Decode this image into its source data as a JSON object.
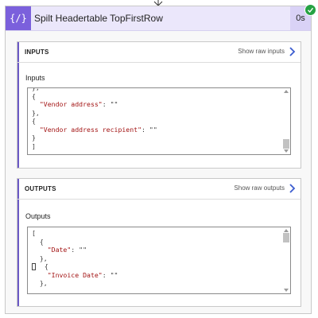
{
  "action": {
    "icon": "{/}",
    "title": "Spilt Headertable TopFirstRow",
    "duration": "0s",
    "status_icon": "success-check",
    "accent_color": "#7b60dc"
  },
  "inputs_panel": {
    "header": "INPUTS",
    "raw_link": "Show raw inputs",
    "section_label": "Inputs",
    "code_lines": [
      [
        "},",
        null
      ],
      [
        "{",
        null
      ],
      [
        "  ",
        "\"Vendor address\"",
        ": \"\""
      ],
      [
        "},",
        null
      ],
      [
        "{",
        null
      ],
      [
        "  ",
        "\"Vendor address recipient\"",
        ": \"\""
      ],
      [
        "}",
        null
      ],
      [
        "]",
        null
      ]
    ]
  },
  "outputs_panel": {
    "header": "OUTPUTS",
    "raw_link": "Show raw outputs",
    "section_label": "Outputs",
    "code_lines": [
      [
        "[",
        null
      ],
      [
        "  {",
        null
      ],
      [
        "    ",
        "\"Date\"",
        ": \"\""
      ],
      [
        "  },",
        null
      ],
      [
        "  {",
        null
      ],
      [
        "    ",
        "\"Invoice Date\"",
        ": \"\""
      ],
      [
        "  },",
        null
      ]
    ]
  }
}
